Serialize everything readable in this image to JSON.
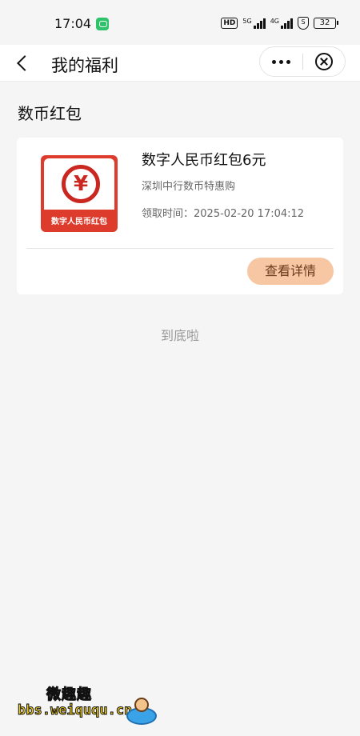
{
  "status_bar": {
    "time": "17:04",
    "hd": "HD",
    "sig1": "5G",
    "sig2": "4G",
    "shield": "S",
    "battery": "32"
  },
  "nav": {
    "title": "我的福利"
  },
  "section_title": "数币红包",
  "card": {
    "thumb_text": "数字人民币红包",
    "thumb_symbol": "¥",
    "title": "数字人民币红包6元",
    "subtitle": "深圳中行数币特惠购",
    "time_label": "领取时间：2025-02-20 17:04:12",
    "detail_button": "查看详情"
  },
  "end_text": "到底啦",
  "watermark": {
    "cn": "微趣趣",
    "en": "bbs.weiququ.cn"
  },
  "colors": {
    "accent": "#f7c6a3",
    "thumb_red": "#dd3b2c",
    "page_bg": "#f5f5f5"
  },
  "icons": [
    "wechat-icon",
    "signal-icon",
    "shield-icon",
    "battery-icon",
    "back-icon",
    "more-icon",
    "close-icon",
    "yuan-icon"
  ]
}
